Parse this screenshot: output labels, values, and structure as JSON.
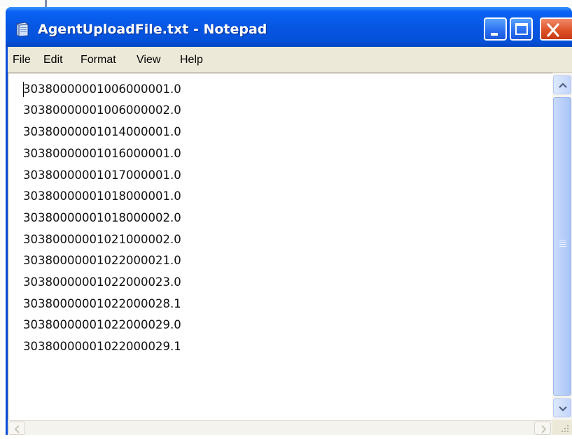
{
  "window": {
    "title": "AgentUploadFile.txt - Notepad"
  },
  "titlebar_buttons": {
    "minimize_icon": "minimize-icon",
    "maximize_icon": "maximize-icon",
    "close_icon": "close-icon"
  },
  "menu": {
    "items": [
      "File",
      "Edit",
      "Format",
      "View",
      "Help"
    ]
  },
  "content": {
    "lines": [
      "30380000001006000001.0",
      "30380000001006000002.0",
      "30380000001014000001.0",
      "30380000001016000001.0",
      "30380000001017000001.0",
      "30380000001018000001.0",
      "30380000001018000002.0",
      "30380000001021000002.0",
      "30380000001022000021.0",
      "30380000001022000023.0",
      "30380000001022000028.1",
      "30380000001022000029.0",
      "30380000001022000029.1"
    ]
  },
  "colors": {
    "titlebar": "#0552d9",
    "title_text": "#ffffff",
    "close_button": "#e0542a",
    "menubar": "#ece9d8"
  }
}
